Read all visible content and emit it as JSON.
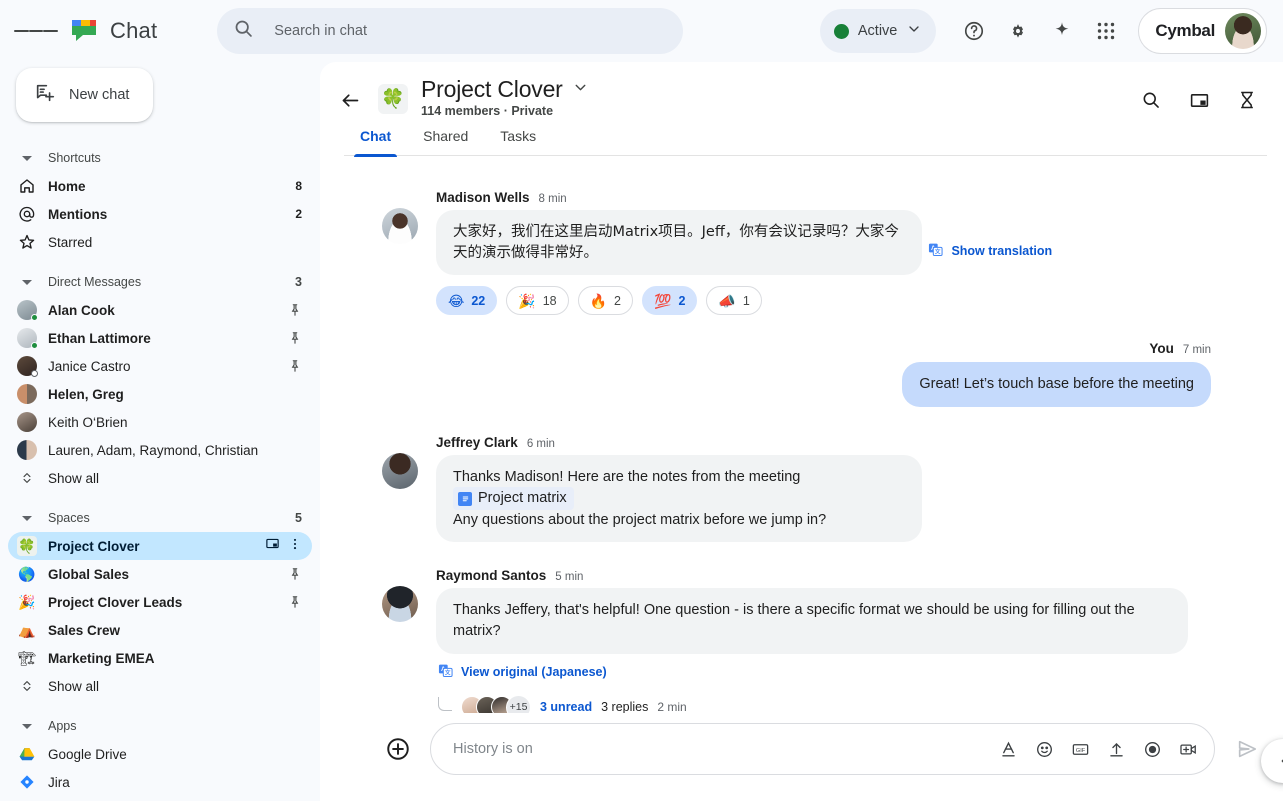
{
  "app": {
    "brand_title": "Chat",
    "logo_icon": "google-chat-logo"
  },
  "topbar": {
    "menu_icon": "hamburger-menu-icon",
    "search": {
      "icon": "search-icon",
      "placeholder": "Search in chat",
      "value": ""
    },
    "status": {
      "label": "Active",
      "dot_color": "#188038",
      "caret_icon": "chevron-down-icon"
    },
    "help_icon": "help-circle-icon",
    "settings_icon": "gear-icon",
    "gemini_icon": "sparkle-icon",
    "apps_icon": "apps-grid-icon",
    "account": {
      "name": "Cymbal",
      "avatar_icon": "user-avatar"
    }
  },
  "sidebar": {
    "new_chat": {
      "label": "New chat",
      "icon": "new-chat-icon"
    },
    "sections": [
      {
        "title": "Shortcuts",
        "count": "",
        "items": [
          {
            "label": "Home",
            "icon": "home-icon",
            "badge": "8",
            "bold": true
          },
          {
            "label": "Mentions",
            "icon": "at-mention-icon",
            "badge": "2",
            "bold": true
          },
          {
            "label": "Starred",
            "icon": "star-icon",
            "badge": "",
            "bold": false
          }
        ]
      },
      {
        "title": "Direct Messages",
        "count": "3",
        "items": [
          {
            "label": "Alan Cook",
            "bold": true,
            "pin": true,
            "presence": "active"
          },
          {
            "label": "Ethan Lattimore",
            "bold": true,
            "pin": true,
            "presence": "active"
          },
          {
            "label": "Janice Castro",
            "bold": false,
            "pin": true,
            "presence": "away"
          },
          {
            "label": "Helen, Greg",
            "bold": true,
            "pin": false,
            "presence": ""
          },
          {
            "label": "Keith O‘Brien",
            "bold": false,
            "pin": false,
            "presence": ""
          },
          {
            "label": "Lauren, Adam, Raymond, Christian",
            "bold": false,
            "pin": false,
            "presence": ""
          }
        ],
        "show_all": "Show all"
      },
      {
        "title": "Spaces",
        "count": "5",
        "items": [
          {
            "label": "Project Clover",
            "emoji": "🍀",
            "bold": true,
            "selected": true,
            "trailing": "open-in-split-icon,more-options-icon"
          },
          {
            "label": "Global Sales",
            "emoji": "🌎",
            "bold": true,
            "pin": true
          },
          {
            "label": "Project Clover Leads",
            "emoji": "🎉",
            "bold": true,
            "pin": true
          },
          {
            "label": "Sales Crew",
            "emoji": "⛺",
            "bold": true,
            "pin": false
          },
          {
            "label": "Marketing EMEA",
            "emoji": "🏗",
            "bold": true,
            "pin": false
          }
        ],
        "show_all": "Show all"
      },
      {
        "title": "Apps",
        "count": "",
        "items": [
          {
            "label": "Google Drive",
            "icon": "google-drive-icon",
            "bold": false
          },
          {
            "label": "Jira",
            "icon": "jira-icon",
            "bold": false
          }
        ]
      }
    ]
  },
  "room": {
    "back_icon": "back-arrow-icon",
    "emoji": "🍀",
    "title": "Project Clover",
    "title_caret_icon": "chevron-down-icon",
    "subtitle": "114 members · Private",
    "actions": [
      "search-icon",
      "open-in-split-icon",
      "hourglass-icon"
    ],
    "tabs": [
      {
        "label": "Chat",
        "active": true
      },
      {
        "label": "Shared",
        "active": false
      },
      {
        "label": "Tasks",
        "active": false
      }
    ]
  },
  "messages": [
    {
      "author": "Madison Wells",
      "time": "8 min",
      "text": "大家好，我们在这里启动Matrix项目。Jeff，你有会议记录吗？大家今天的演示做得非常好。",
      "translate_label": "Show translation",
      "reactions": [
        {
          "emoji": "😂",
          "count": "22",
          "selected": true
        },
        {
          "emoji": "🎉",
          "count": "18",
          "selected": false
        },
        {
          "emoji": "🔥",
          "count": "2",
          "selected": false
        },
        {
          "emoji": "💯",
          "count": "2",
          "selected": true
        },
        {
          "emoji": "📣",
          "count": "1",
          "selected": false
        }
      ]
    },
    {
      "author": "You",
      "time": "7 min",
      "own": true,
      "text": "Great! Let’s touch base before the meeting"
    },
    {
      "author": "Jeffrey Clark",
      "time": "6 min",
      "text_part1": "Thanks Madison!  Here are the notes from the meeting ",
      "link_label": "Project matrix",
      "link_icon": "google-doc-icon",
      "text_part2": "Any questions about the project matrix before we jump in?"
    },
    {
      "author": "Raymond Santos",
      "time": "5 min",
      "text": "Thanks Jeffery, that's helpful!  One question -  is there a specific format we should be using for filling out the matrix?",
      "translate_label": "View original (Japanese)",
      "thread": {
        "more_count": "+15",
        "unread": "3 unread",
        "replies": "3 replies",
        "time": "2 min"
      }
    }
  ],
  "composer": {
    "plus_icon": "add-circle-icon",
    "placeholder": "History is on",
    "value": "",
    "tools": [
      "format-text-icon",
      "emoji-icon",
      "gif-icon",
      "upload-file-icon",
      "record-icon",
      "video-meeting-icon"
    ],
    "send_icon": "send-icon"
  },
  "edge_panel_toggle_icon": "chevron-left-icon",
  "colors": {
    "accent": "#0b57d0",
    "selected_nav": "#c2e7ff",
    "own_bubble": "#c5dafc",
    "bubble": "#f1f3f4",
    "active_status": "#188038"
  }
}
